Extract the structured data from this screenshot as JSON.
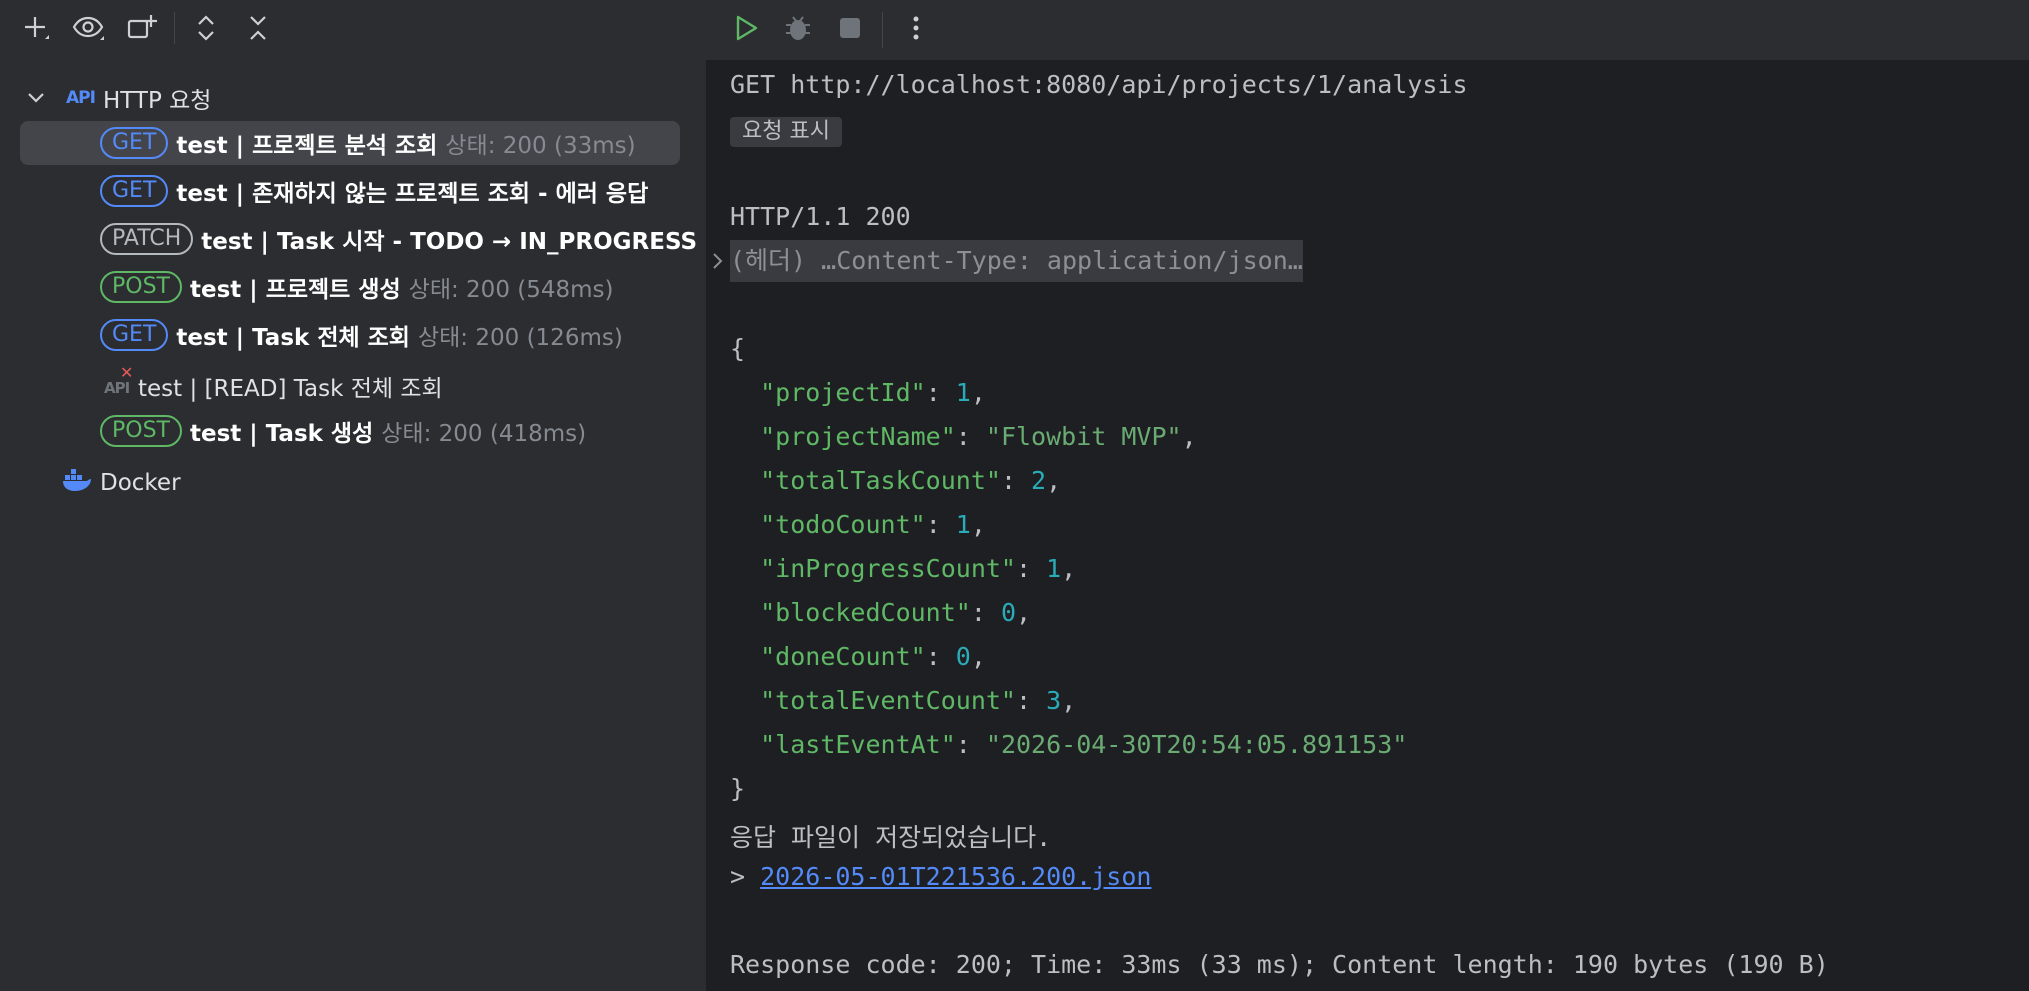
{
  "left_toolbar": {
    "add_icon": "plus-icon",
    "view_icon": "eye-icon",
    "new_icon": "new-window-icon",
    "expand_icon": "expand-all-icon",
    "collapse_icon": "collapse-all-icon"
  },
  "tree": {
    "http_group_label": "HTTP 요청",
    "items": [
      {
        "method": "GET",
        "name": "test  |  프로젝트 분석 조회",
        "status": "상태: 200 (33ms)"
      },
      {
        "method": "GET",
        "name": "test  |  존재하지 않는 프로젝트 조회 - 에러 응답",
        "status": ""
      },
      {
        "method": "PATCH",
        "name": "test  |  Task 시작 - TODO → IN_PROGRESS",
        "status": ""
      },
      {
        "method": "POST",
        "name": "test  |  프로젝트 생성",
        "status": "상태: 200 (548ms)"
      },
      {
        "method": "GET",
        "name": "test  |  Task 전체 조회",
        "status": "상태: 200 (126ms)"
      },
      {
        "method": "",
        "name": "test | [READ] Task 전체 조회",
        "status": ""
      },
      {
        "method": "POST",
        "name": "test  |  Task 생성",
        "status": "상태: 200 (418ms)"
      }
    ],
    "docker_label": "Docker"
  },
  "response": {
    "request_line": "GET http://localhost:8080/api/projects/1/analysis",
    "show_request_chip": "요청 표시",
    "status_line": "HTTP/1.1 200",
    "headers_folded": "(헤더) …Content-Type: application/json…",
    "json_open": "{",
    "json_close": "}",
    "fields": [
      {
        "key": "\"projectId\"",
        "value": "1",
        "type": "number",
        "comma": ","
      },
      {
        "key": "\"projectName\"",
        "value": "\"Flowbit MVP\"",
        "type": "string",
        "comma": ","
      },
      {
        "key": "\"totalTaskCount\"",
        "value": "2",
        "type": "number",
        "comma": ","
      },
      {
        "key": "\"todoCount\"",
        "value": "1",
        "type": "number",
        "comma": ","
      },
      {
        "key": "\"inProgressCount\"",
        "value": "1",
        "type": "number",
        "comma": ","
      },
      {
        "key": "\"blockedCount\"",
        "value": "0",
        "type": "number",
        "comma": ","
      },
      {
        "key": "\"doneCount\"",
        "value": "0",
        "type": "number",
        "comma": ","
      },
      {
        "key": "\"totalEventCount\"",
        "value": "3",
        "type": "number",
        "comma": ","
      },
      {
        "key": "\"lastEventAt\"",
        "value": "\"2026-04-30T20:54:05.891153\"",
        "type": "string",
        "comma": ""
      }
    ],
    "saved_message": "응답 파일이 저장되었습니다.",
    "saved_prefix": "> ",
    "saved_file": "2026-05-01T221536.200.json",
    "summary": "Response code: 200; Time: 33ms (33 ms); Content length: 190 bytes (190 B)"
  },
  "colors": {
    "get": "#548af7",
    "post": "#5fb865",
    "patch": "#b4b8bf",
    "json_key": "#5fb865",
    "json_number": "#2aacb8",
    "json_string": "#6aab73"
  }
}
